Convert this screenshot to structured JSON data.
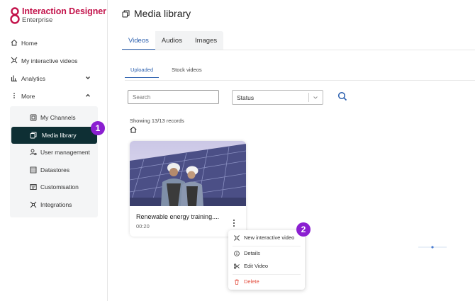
{
  "brand": {
    "name": "Interaction Designer",
    "subtitle": "Enterprise",
    "accent": "#c3134b"
  },
  "sidebar": {
    "items": [
      {
        "label": "Home",
        "icon": "home-icon"
      },
      {
        "label": "My interactive videos",
        "icon": "interactive-icon"
      },
      {
        "label": "Analytics",
        "icon": "chart-icon"
      },
      {
        "label": "More",
        "icon": "more-icon"
      }
    ],
    "submenu": [
      {
        "label": "My Channels",
        "icon": "channels-icon"
      },
      {
        "label": "Media library",
        "icon": "media-icon",
        "active": true
      },
      {
        "label": "User management",
        "icon": "user-icon"
      },
      {
        "label": "Datastores",
        "icon": "database-icon"
      },
      {
        "label": "Customisation",
        "icon": "customise-icon"
      },
      {
        "label": "Integrations",
        "icon": "integrations-icon"
      }
    ],
    "active_color": "#0e2f34"
  },
  "badges": {
    "one": "1",
    "two": "2",
    "color": "#8b1fd1"
  },
  "main": {
    "title": "Media library",
    "tabs": [
      {
        "label": "Videos"
      },
      {
        "label": "Audios"
      },
      {
        "label": "Images"
      }
    ],
    "subtabs": [
      {
        "label": "Uploaded"
      },
      {
        "label": "Stock videos"
      }
    ],
    "search_placeholder": "Search",
    "status_label": "Status",
    "records_text": "Showing 13/13 records"
  },
  "card": {
    "title": "Renewable energy training....",
    "duration": "00:20"
  },
  "context_menu": {
    "items": [
      {
        "label": "New interactive video",
        "icon": "interactive-icon"
      },
      {
        "label": "Details",
        "icon": "info-icon"
      },
      {
        "label": "Edit Video",
        "icon": "scissors-icon"
      },
      {
        "label": "Delete",
        "icon": "trash-icon"
      }
    ]
  }
}
